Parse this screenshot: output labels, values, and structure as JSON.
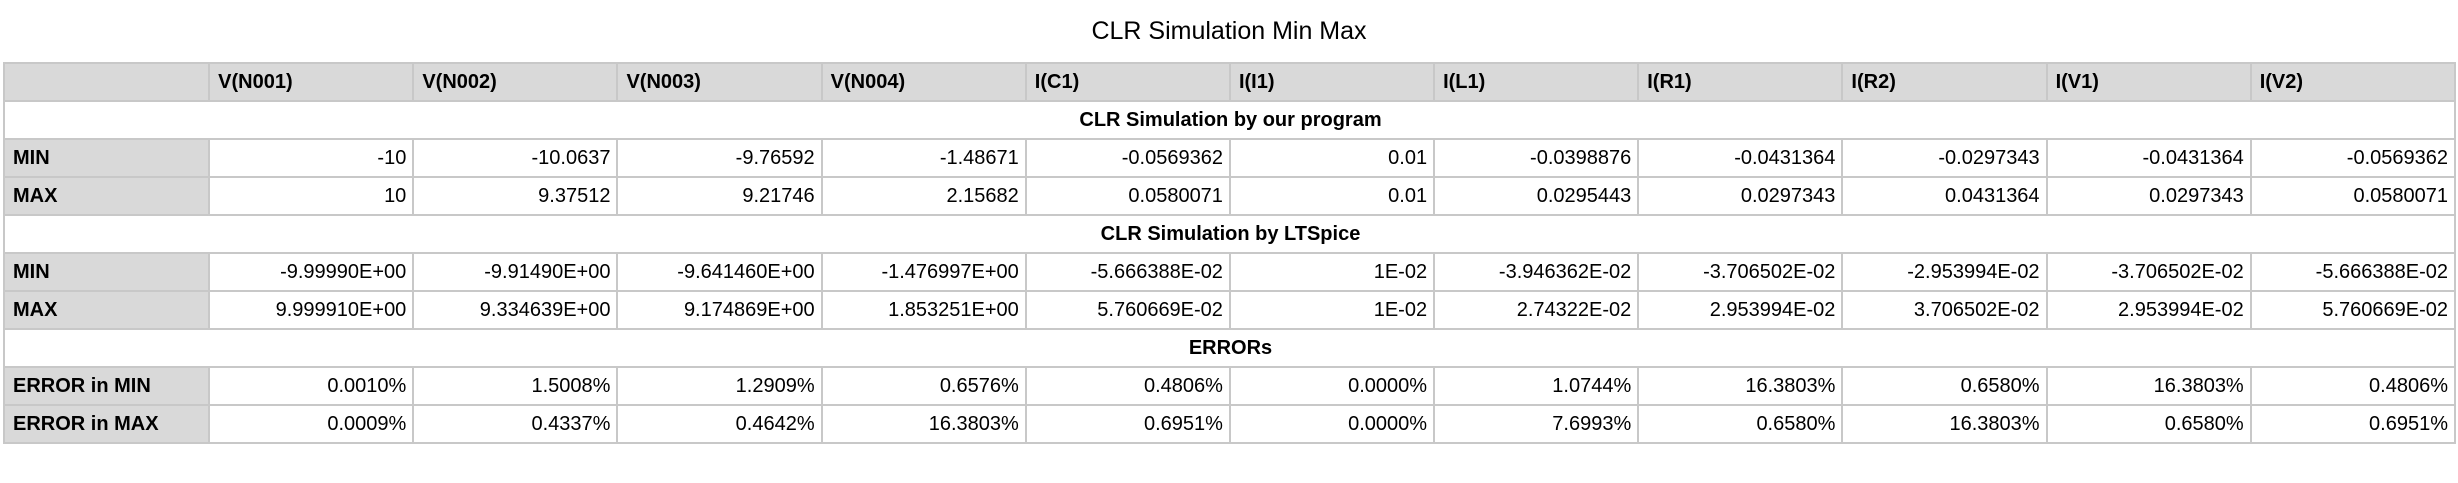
{
  "title": "CLR Simulation Min Max",
  "columns": [
    "",
    "V(N001)",
    "V(N002)",
    "V(N003)",
    "V(N004)",
    "I(C1)",
    "I(I1)",
    "I(L1)",
    "I(R1)",
    "I(R2)",
    "I(V1)",
    "I(V2)"
  ],
  "sections": [
    {
      "heading": "CLR Simulation by our program",
      "rows": [
        {
          "label": "MIN",
          "values": [
            "-10",
            "-10.0637",
            "-9.76592",
            "-1.48671",
            "-0.0569362",
            "0.01",
            "-0.0398876",
            "-0.0431364",
            "-0.0297343",
            "-0.0431364",
            "-0.0569362"
          ]
        },
        {
          "label": "MAX",
          "values": [
            "10",
            "9.37512",
            "9.21746",
            "2.15682",
            "0.0580071",
            "0.01",
            "0.0295443",
            "0.0297343",
            "0.0431364",
            "0.0297343",
            "0.0580071"
          ]
        }
      ]
    },
    {
      "heading": "CLR Simulation by LTSpice",
      "rows": [
        {
          "label": "MIN",
          "values": [
            "-9.99990E+00",
            "-9.91490E+00",
            "-9.641460E+00",
            "-1.476997E+00",
            "-5.666388E-02",
            "1E-02",
            "-3.946362E-02",
            "-3.706502E-02",
            "-2.953994E-02",
            "-3.706502E-02",
            "-5.666388E-02"
          ]
        },
        {
          "label": "MAX",
          "values": [
            "9.999910E+00",
            "9.334639E+00",
            "9.174869E+00",
            "1.853251E+00",
            "5.760669E-02",
            "1E-02",
            "2.74322E-02",
            "2.953994E-02",
            "3.706502E-02",
            "2.953994E-02",
            "5.760669E-02"
          ]
        }
      ]
    },
    {
      "heading": "ERRORs",
      "rows": [
        {
          "label": "ERROR in MIN",
          "values": [
            "0.0010%",
            "1.5008%",
            "1.2909%",
            "0.6576%",
            "0.4806%",
            "0.0000%",
            "1.0744%",
            "16.3803%",
            "0.6580%",
            "16.3803%",
            "0.4806%"
          ]
        },
        {
          "label": "ERROR in MAX",
          "values": [
            "0.0009%",
            "0.4337%",
            "0.4642%",
            "16.3803%",
            "0.6951%",
            "0.0000%",
            "7.6993%",
            "0.6580%",
            "16.3803%",
            "0.6580%",
            "0.6951%"
          ]
        }
      ]
    }
  ]
}
